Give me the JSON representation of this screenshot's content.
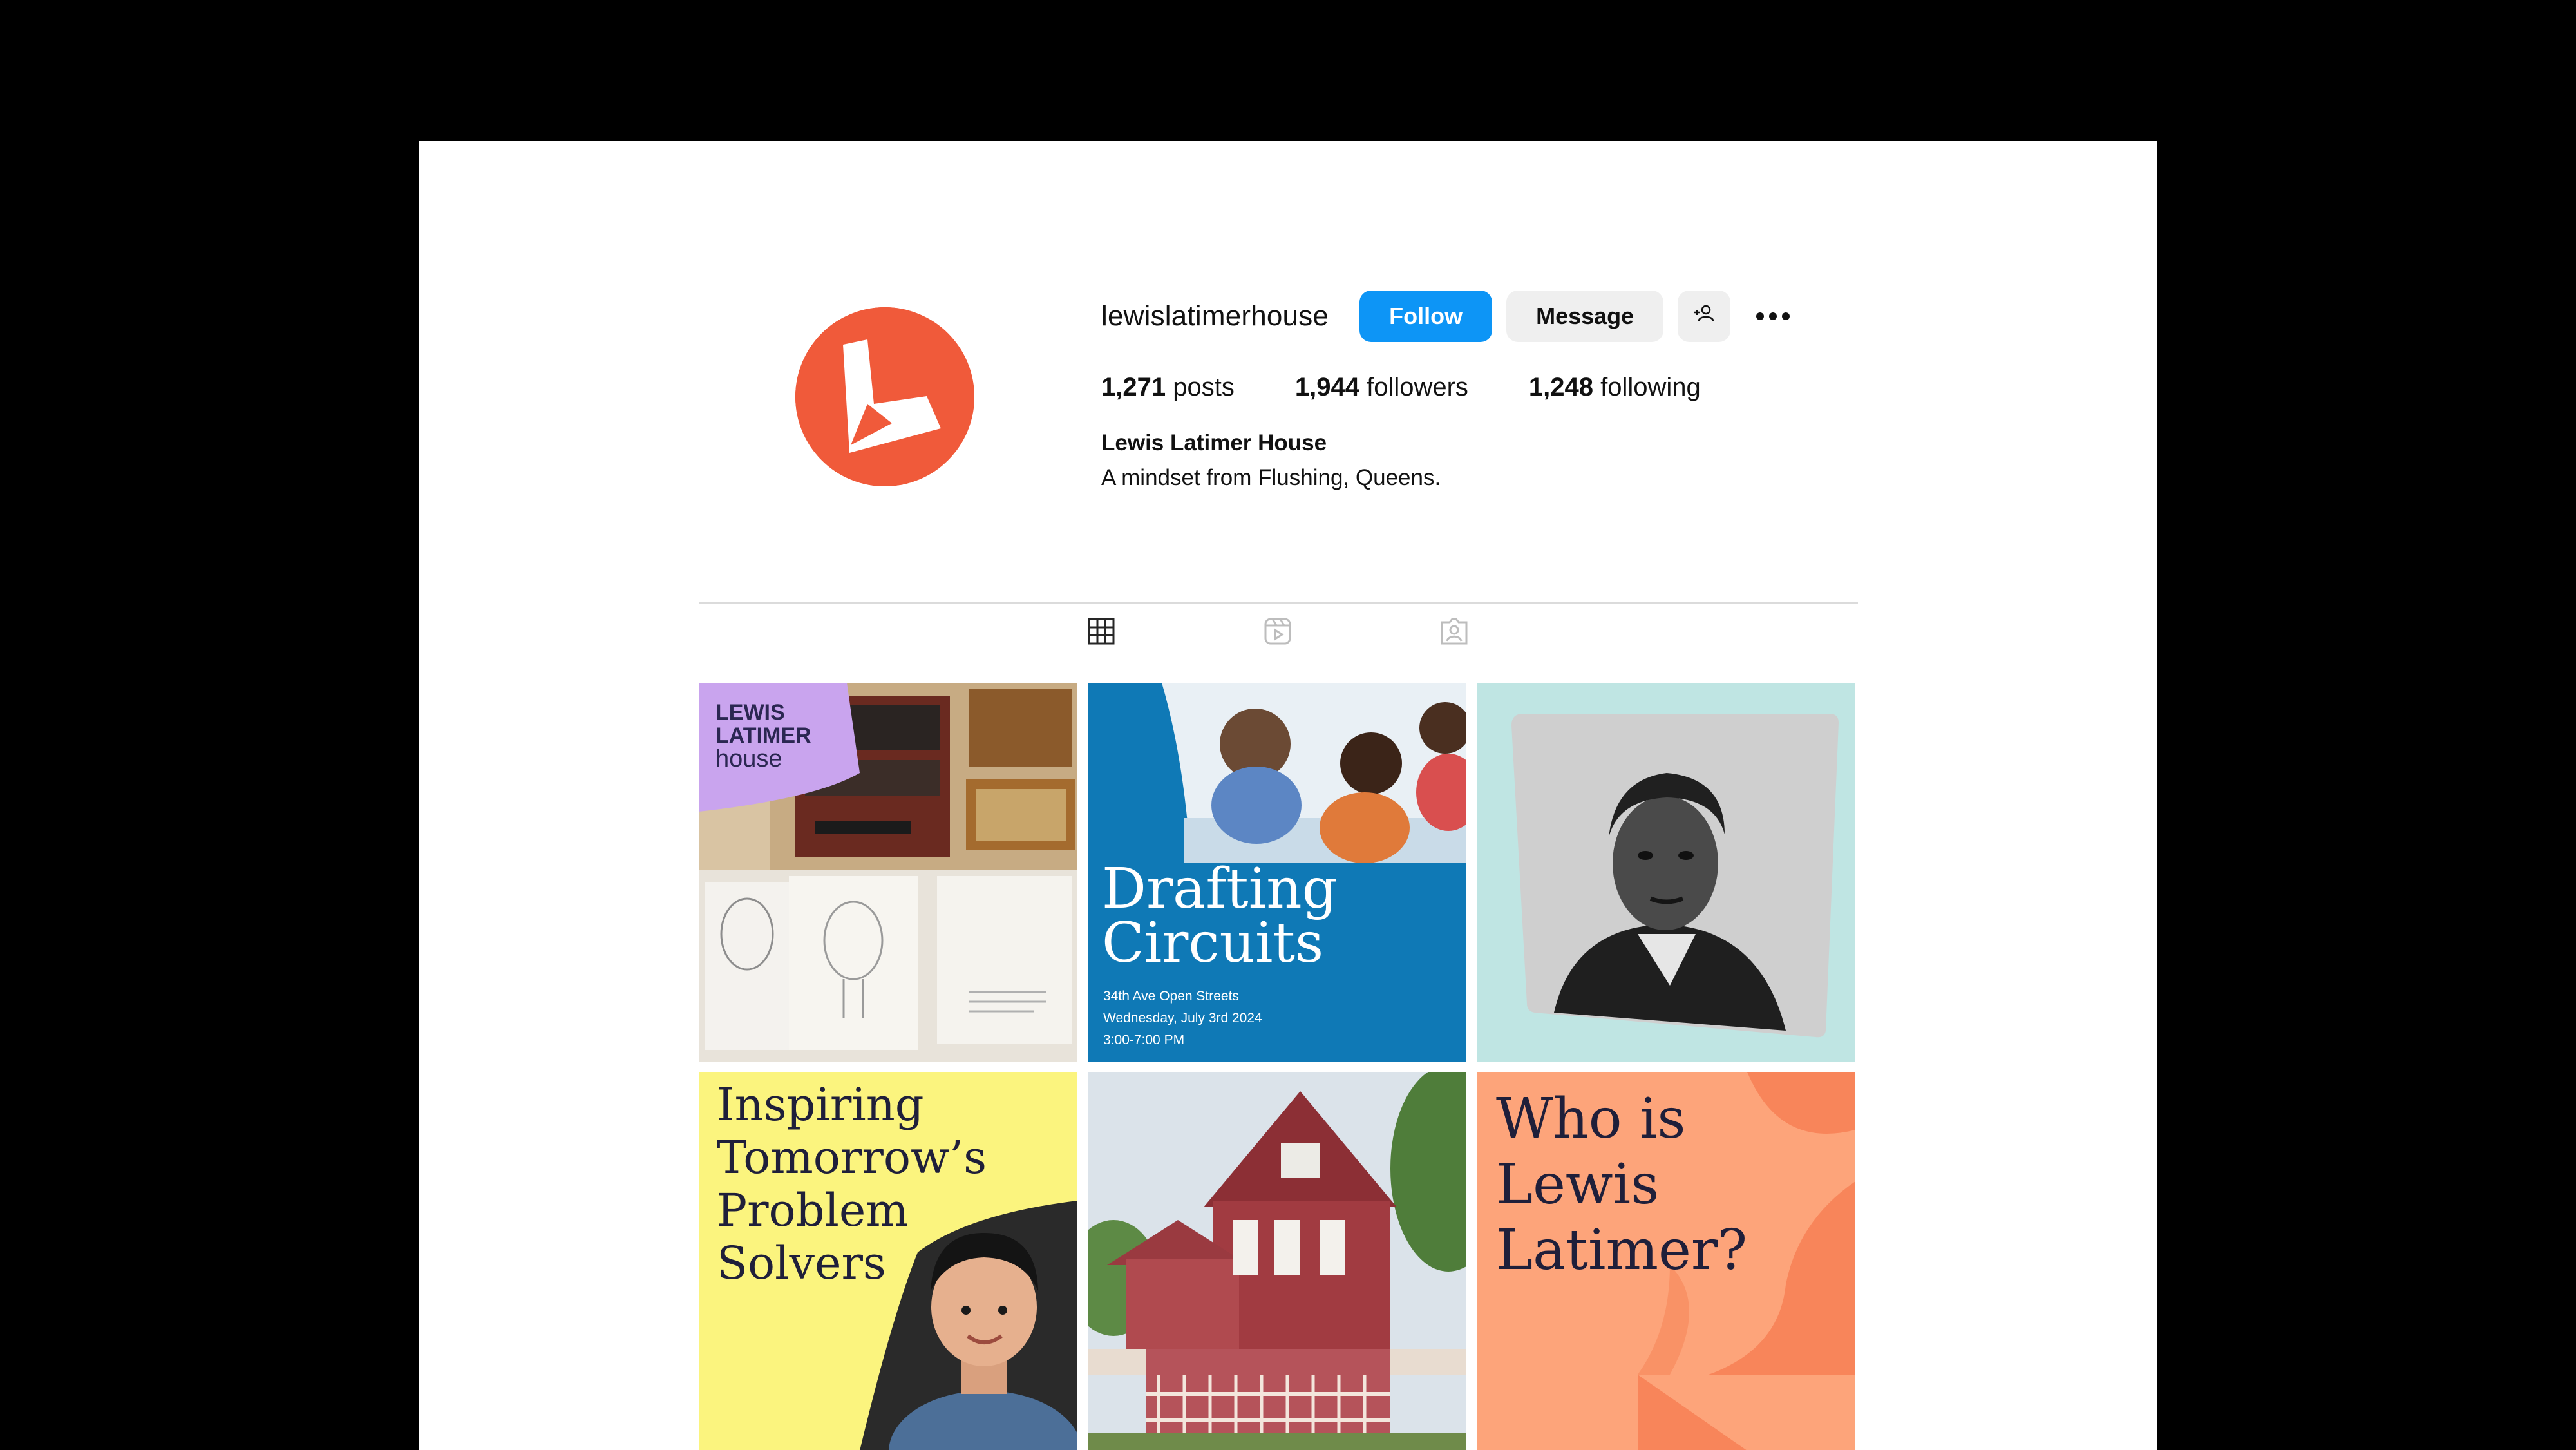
{
  "profile": {
    "username": "lewislatimerhouse",
    "follow_label": "Follow",
    "message_label": "Message",
    "add_user_icon": "add-user-icon",
    "more_icon": "more-options-icon",
    "stats": {
      "posts_count": "1,271",
      "posts_label": "posts",
      "followers_count": "1,944",
      "followers_label": "followers",
      "following_count": "1,248",
      "following_label": "following"
    },
    "full_name": "Lewis Latimer House",
    "bio": "A mindset from Flushing, Queens.",
    "avatar_color": "#f05a3a"
  },
  "tabs": [
    {
      "icon": "grid-icon",
      "active": true
    },
    {
      "icon": "reels-icon",
      "active": false
    },
    {
      "icon": "tagged-icon",
      "active": false
    }
  ],
  "posts": {
    "post1": {
      "line1": "LEWIS",
      "line2": "LATIMER",
      "line3": "house"
    },
    "post2": {
      "title_line1": "Drafting",
      "title_line2": "Circuits",
      "meta_line1": "34th Ave Open Streets",
      "meta_line2": "Wednesday, July 3rd 2024",
      "meta_line3": "3:00-7:00 PM"
    },
    "post4": {
      "line1": "Inspiring",
      "line2": "Tomorrow’s",
      "line3": "Problem",
      "line4": "Solvers"
    },
    "post6": {
      "line1": "Who is",
      "line2": "Lewis",
      "line3": "Latimer?"
    }
  },
  "colors": {
    "follow_blue": "#0d95f6",
    "post2_blue": "#0f79b6",
    "post3_bg": "#bfe5e3",
    "post4_yellow": "#fbf47e",
    "post6_orange": "#fda47a",
    "lavender": "#c9a4ee"
  }
}
